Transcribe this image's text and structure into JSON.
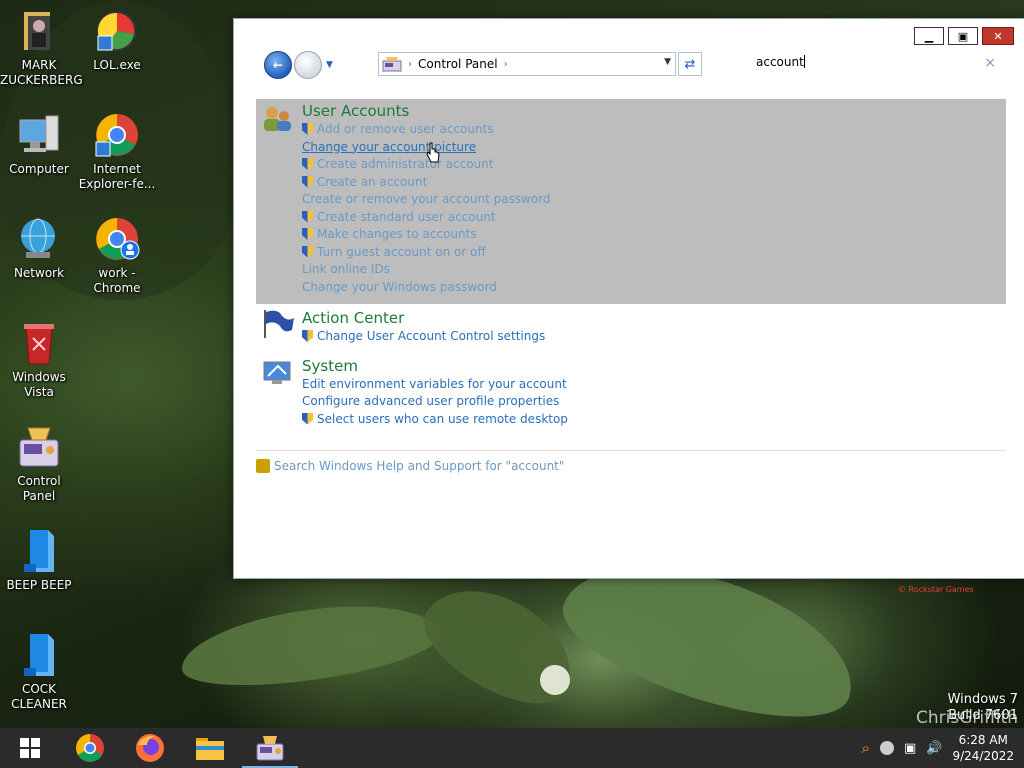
{
  "desktop": {
    "icons": [
      {
        "label": "MARK ZUCKERBERG",
        "icon": "folder-person-icon"
      },
      {
        "label": "LOL.exe",
        "icon": "app-icon"
      },
      {
        "label": "Computer",
        "icon": "computer-icon"
      },
      {
        "label": "Internet Explorer-fe...",
        "icon": "chrome-icon"
      },
      {
        "label": "Network",
        "icon": "network-icon"
      },
      {
        "label": "work - Chrome",
        "icon": "chrome-profile-icon"
      },
      {
        "label": "Windows Vista",
        "icon": "recycle-bin-icon"
      },
      {
        "label": "Control Panel",
        "icon": "control-panel-icon"
      },
      {
        "label": "BEEP BEEP",
        "icon": "blue-file-icon"
      },
      {
        "label": "COCK CLEANER",
        "icon": "blue-file-icon"
      }
    ]
  },
  "window": {
    "address": {
      "crumb": "Control Panel"
    },
    "search": {
      "value": "account"
    },
    "groups": [
      {
        "title": "User Accounts",
        "links": [
          {
            "text": "Add or remove user accounts",
            "shield": true
          },
          {
            "text": "Change your account picture",
            "shield": false
          },
          {
            "text": "Create administrator account",
            "shield": true
          },
          {
            "text": "Create an account",
            "shield": true
          },
          {
            "text": "Create or remove your account password",
            "shield": false
          },
          {
            "text": "Create standard user account",
            "shield": true
          },
          {
            "text": "Make changes to accounts",
            "shield": true
          },
          {
            "text": "Turn guest account on or off",
            "shield": true
          },
          {
            "text": "Link online IDs",
            "shield": false
          },
          {
            "text": "Change your Windows password",
            "shield": false
          }
        ]
      },
      {
        "title": "Action Center",
        "links": [
          {
            "text": "Change User Account Control settings",
            "shield": true
          }
        ]
      },
      {
        "title": "System",
        "links": [
          {
            "text": "Edit environment variables for your account",
            "shield": false
          },
          {
            "text": "Configure advanced user profile properties",
            "shield": false
          },
          {
            "text": "Select users who can use remote desktop",
            "shield": true
          }
        ]
      }
    ],
    "help_link": "Search Windows Help and Support for \"account\""
  },
  "overlay": {
    "rockstar": "© Rockstar Games",
    "watermark_line1": "Windows 7",
    "watermark_line2": "Build 7601",
    "watermark_name": "ChrisGriffith"
  },
  "taskbar": {
    "time": "6:28 AM",
    "date": "9/24/2022"
  }
}
